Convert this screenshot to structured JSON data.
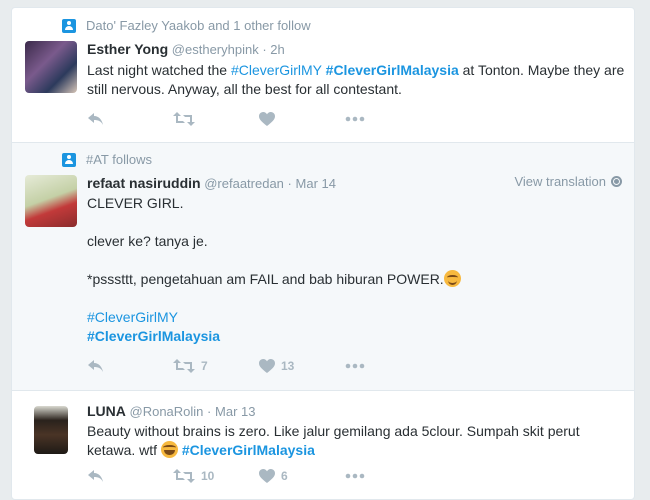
{
  "colors": {
    "link": "#1b95e0",
    "meta": "#8899a6",
    "icon": "#aab8c2",
    "text": "#292f33",
    "highlight_bg": "#f5f8fa"
  },
  "tweets": [
    {
      "context": "Dato' Fazley Yaakob and 1 other follow",
      "name": "Esther Yong",
      "handle": "@estheryhpink",
      "sep": "·",
      "time": "2h",
      "text_a": "Last night watched the ",
      "tag_a": "#CleverGirlMY",
      "tag_b": "#CleverGirlMalaysia",
      "text_b": " at Tonton. Maybe they are still nervous. Anyway, all the best for all contestant.",
      "retweets": "",
      "likes": ""
    },
    {
      "context": "#AT follows",
      "name": "refaat nasiruddin",
      "handle": "@refaatredan",
      "sep": "·",
      "time": "Mar 14",
      "view_translation": "View translation",
      "line1": "CLEVER GIRL.",
      "line2": "clever ke? tanya je.",
      "line3": "*psssttt, pengetahuan am FAIL and bab hiburan POWER.",
      "tag_a": "#CleverGirlMY",
      "tag_b": "#CleverGirlMalaysia",
      "retweets": "7",
      "likes": "13"
    },
    {
      "name": "LUNA",
      "handle": "@RonaRolin",
      "sep": "·",
      "time": "Mar 13",
      "text_a": "Beauty without brains is zero. Like jalur gemilang ada 5clour. Sumpah skit perut ketawa. wtf ",
      "tag_b": "#CleverGirlMalaysia",
      "retweets": "10",
      "likes": "6"
    }
  ]
}
